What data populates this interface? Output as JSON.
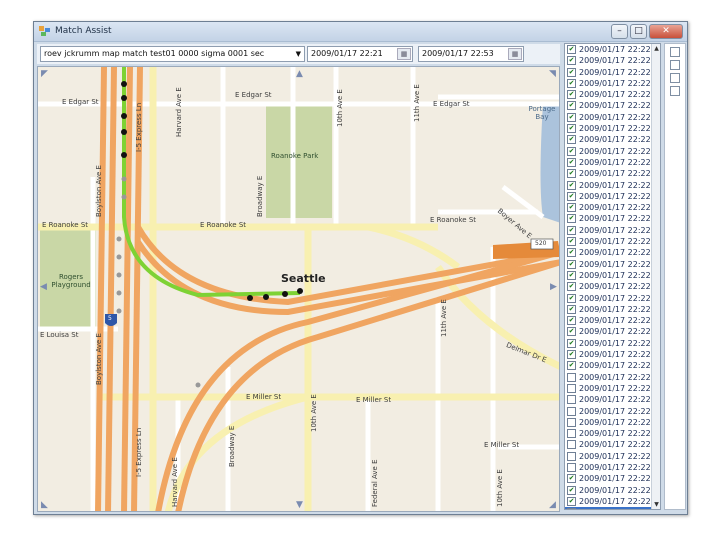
{
  "window": {
    "title": "Match Assist",
    "buttons": {
      "minimize": "–",
      "maximize": "□",
      "close": "✕"
    }
  },
  "toolbar": {
    "dataset_value": "roev jckrumm map match test01 0000 sigma 0001 sec",
    "start_time": "2009/01/17 22:21",
    "end_time": "2009/01/17 22:53"
  },
  "map": {
    "streets": {
      "e_edgar_st": "E Edgar St",
      "e_roanoke_st": "E Roanoke St",
      "e_louisa_st": "E Louisa St",
      "e_miller_st": "E Miller St",
      "harvard_ave_e": "Harvard Ave E",
      "tenth_ave_e": "10th Ave E",
      "eleventh_ave_e": "11th Ave E",
      "boylston_ave_e": "Boylston Ave E",
      "broadway_e": "Broadway E",
      "federal_ave_e": "Federal Ave E",
      "boyer_ave_e": "Boyer Ave E",
      "delmar_dr_e": "Delmar Dr E",
      "i5_express_ln": "I-5 Express Ln",
      "portage_bay": "Portage Bay"
    },
    "places": {
      "roanoke_park": "Roanoke Park",
      "rogers_playground": "Rogers Playground",
      "city": "Seattle"
    },
    "shields": {
      "interstate": "5",
      "route": "520"
    },
    "colors": {
      "background": "#f2ede2",
      "park": "#c9d7a6",
      "water": "#abc3dc",
      "highway": "#f0a561",
      "arterial": "#f8f0b0",
      "minor": "#ffffff",
      "route": "#7ed234"
    }
  },
  "list": {
    "items": [
      {
        "time": "2009/01/17 22:22",
        "checked": true
      },
      {
        "time": "2009/01/17 22:22",
        "checked": true
      },
      {
        "time": "2009/01/17 22:22",
        "checked": true
      },
      {
        "time": "2009/01/17 22:22",
        "checked": true
      },
      {
        "time": "2009/01/17 22:22",
        "checked": true
      },
      {
        "time": "2009/01/17 22:22",
        "checked": true
      },
      {
        "time": "2009/01/17 22:22",
        "checked": true
      },
      {
        "time": "2009/01/17 22:22",
        "checked": true
      },
      {
        "time": "2009/01/17 22:22",
        "checked": true
      },
      {
        "time": "2009/01/17 22:22",
        "checked": true
      },
      {
        "time": "2009/01/17 22:22",
        "checked": true
      },
      {
        "time": "2009/01/17 22:22",
        "checked": true
      },
      {
        "time": "2009/01/17 22:22",
        "checked": true
      },
      {
        "time": "2009/01/17 22:22",
        "checked": true
      },
      {
        "time": "2009/01/17 22:22",
        "checked": true
      },
      {
        "time": "2009/01/17 22:22",
        "checked": true
      },
      {
        "time": "2009/01/17 22:22",
        "checked": true
      },
      {
        "time": "2009/01/17 22:22",
        "checked": true
      },
      {
        "time": "2009/01/17 22:22",
        "checked": true
      },
      {
        "time": "2009/01/17 22:22",
        "checked": true
      },
      {
        "time": "2009/01/17 22:22",
        "checked": true
      },
      {
        "time": "2009/01/17 22:22",
        "checked": true
      },
      {
        "time": "2009/01/17 22:22",
        "checked": true
      },
      {
        "time": "2009/01/17 22:22",
        "checked": true
      },
      {
        "time": "2009/01/17 22:22",
        "checked": true
      },
      {
        "time": "2009/01/17 22:22",
        "checked": true
      },
      {
        "time": "2009/01/17 22:22",
        "checked": true
      },
      {
        "time": "2009/01/17 22:22",
        "checked": true
      },
      {
        "time": "2009/01/17 22:22",
        "checked": true
      },
      {
        "time": "2009/01/17 22:22",
        "checked": false
      },
      {
        "time": "2009/01/17 22:22",
        "checked": false
      },
      {
        "time": "2009/01/17 22:22",
        "checked": false
      },
      {
        "time": "2009/01/17 22:22",
        "checked": false
      },
      {
        "time": "2009/01/17 22:22",
        "checked": false
      },
      {
        "time": "2009/01/17 22:22",
        "checked": false
      },
      {
        "time": "2009/01/17 22:22",
        "checked": false
      },
      {
        "time": "2009/01/17 22:22",
        "checked": false
      },
      {
        "time": "2009/01/17 22:22",
        "checked": false
      },
      {
        "time": "2009/01/17 22:22",
        "checked": true
      },
      {
        "time": "2009/01/17 22:22",
        "checked": true
      },
      {
        "time": "2009/01/17 22:22",
        "checked": true
      },
      {
        "time": "2009/01/17 22:22",
        "checked": true,
        "selected": true
      }
    ]
  }
}
